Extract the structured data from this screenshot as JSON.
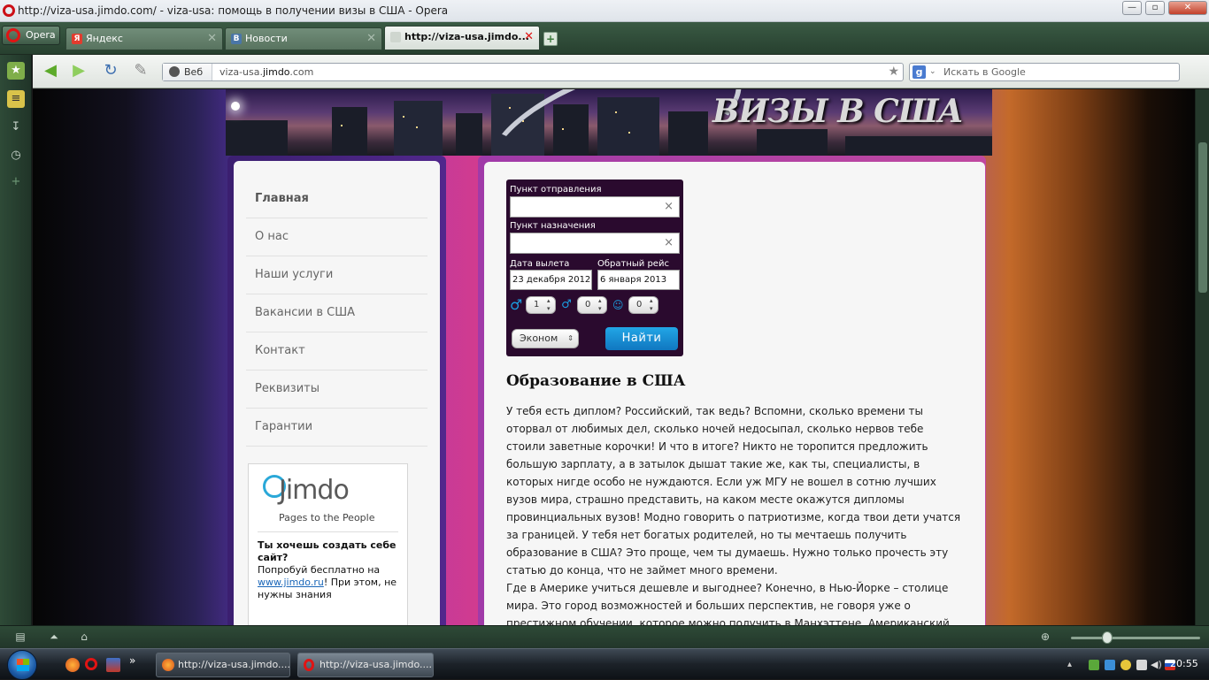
{
  "window": {
    "title": "http://viza-usa.jimdo.com/ - viza-usa: помощь в получении визы в США - Opera",
    "buttons": {
      "minimize": "—",
      "maximize": "▫",
      "close": "✕"
    }
  },
  "tabs": {
    "menu_label": "Opera",
    "items": [
      {
        "label": "Яндекс",
        "icon": "Я"
      },
      {
        "label": "Новости",
        "icon": "B"
      },
      {
        "label": "http://viza-usa.jimdo...",
        "icon": ""
      }
    ]
  },
  "address": {
    "web_label": "Веб",
    "url_prefix": "viza-usa.",
    "url_domain": "jimdo",
    "url_suffix": ".com",
    "search_placeholder": "Искать в Google",
    "search_engine": "g"
  },
  "site": {
    "title": "ВИЗЫ В США",
    "nav": [
      "Главная",
      "О нас",
      "Наши услуги",
      "Вакансии в США",
      "Контакт",
      "Реквизиты",
      "Гарантии"
    ],
    "jimdo": {
      "logo": "Jimdo",
      "tagline": "Pages to the People",
      "promo_heading": "Ты хочешь создать себе сайт?",
      "promo_text_1": "Попробуй бесплатно на ",
      "promo_link": "www.jimdo.ru",
      "promo_text_2": "! При этом, не нужны знания"
    }
  },
  "widget": {
    "from_label": "Пункт отправления",
    "from_value": "",
    "to_label": "Пункт назначения",
    "to_value": "",
    "clear": "×",
    "depart_label": "Дата вылета",
    "depart_value": "23 декабря 2012",
    "return_label": "Обратный рейс",
    "return_value": "6 января 2013",
    "adults": "1",
    "children": "0",
    "infants": "0",
    "class_value": "Эконом",
    "search_button": "Найти"
  },
  "article": {
    "title": "Образование в США",
    "paragraphs": [
      "У тебя есть диплом? Российский, так ведь? Вспомни, сколько времени ты оторвал от любимых дел, сколько ночей недосыпал, сколько нервов тебе стоили заветные корочки! И что в итоге? Никто не торопится предложить большую зарплату, а в затылок дышат такие же, как ты, специалисты, в которых нигде особо не нуждаются. Если уж МГУ не вошел в сотню лучших вузов мира, страшно представить, на каком месте окажутся дипломы провинциальных вузов! Модно говорить о патриотизме, когда твои дети учатся за границей. У тебя нет богатых родителей, но ты мечтаешь получить образование в США? Это проще, чем ты думаешь. Нужно только прочесть эту статью до конца, что не займет много времени.",
      "Где в Америке учиться дешевле и выгоднее? Конечно, в Нью-Йорке – столице мира. Это город возможностей и больших перспектив, не говоря уже о престижном обучении, которое можно получить в Манхэттене. Американский диплом повысит"
    ]
  },
  "taskbar": {
    "tasks": [
      "http://viza-usa.jimdo....",
      "http://viza-usa.jimdo...."
    ],
    "clock": "20:55",
    "quicklaunch_more": "»"
  },
  "colors": {
    "opera_red": "#e01414",
    "browser_green": "#2e4a37",
    "find_button": "#1a8ed6",
    "widget_bg": "#2a0a2e"
  }
}
